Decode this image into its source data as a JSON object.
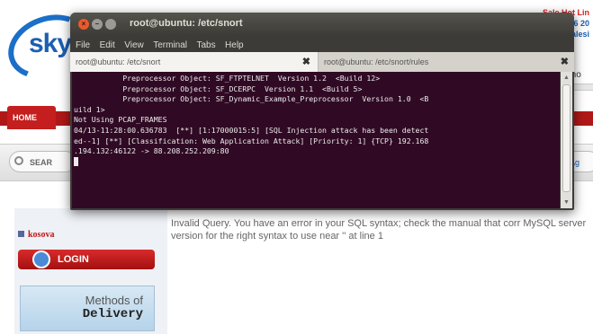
{
  "website": {
    "logo_text": "sky",
    "top_right": {
      "line1": "Sale Hot Lin",
      "line2": "6 20",
      "line3": "alesi"
    },
    "side_label": "Sho",
    "nav": {
      "home_tab": "HOME"
    },
    "search": {
      "label": "SEAR",
      "right_label": "Ag"
    },
    "sidebar": {
      "kosova_link": "kosova",
      "login_button": "LOGIN",
      "methods_line1": "Methods of",
      "methods_line2": "Delivery"
    },
    "error_message": "Invalid Query. You have an error in your SQL syntax; check the manual that corr MySQL server version for the right syntax to use near '' at line 1"
  },
  "terminal": {
    "title": "root@ubuntu: /etc/snort",
    "menu": [
      "File",
      "Edit",
      "View",
      "Terminal",
      "Tabs",
      "Help"
    ],
    "tabs": [
      {
        "label": "root@ubuntu: /etc/snort",
        "close": "✖"
      },
      {
        "label": "root@ubuntu: /etc/snort/rules",
        "close": "✖"
      }
    ],
    "lines": [
      "           Preprocessor Object: SF_FTPTELNET  Version 1.2  <Build 12>",
      "           Preprocessor Object: SF_DCERPC  Version 1.1  <Build 5>",
      "           Preprocessor Object: SF_Dynamic_Example_Preprocessor  Version 1.0  <B",
      "uild 1>",
      "Not Using PCAP_FRAMES",
      "04/13-11:28:00.636783  [**] [1:17000015:5] [SQL Injection attack has been detect",
      "ed--1] [**] [Classification: Web Application Attack] [Priority: 1] {TCP} 192.168",
      ".194.132:46122 -> 88.208.252.209:80"
    ],
    "colors": {
      "background": "#300a24",
      "text": "#ececec",
      "titlebar": "#3c3b37"
    }
  }
}
